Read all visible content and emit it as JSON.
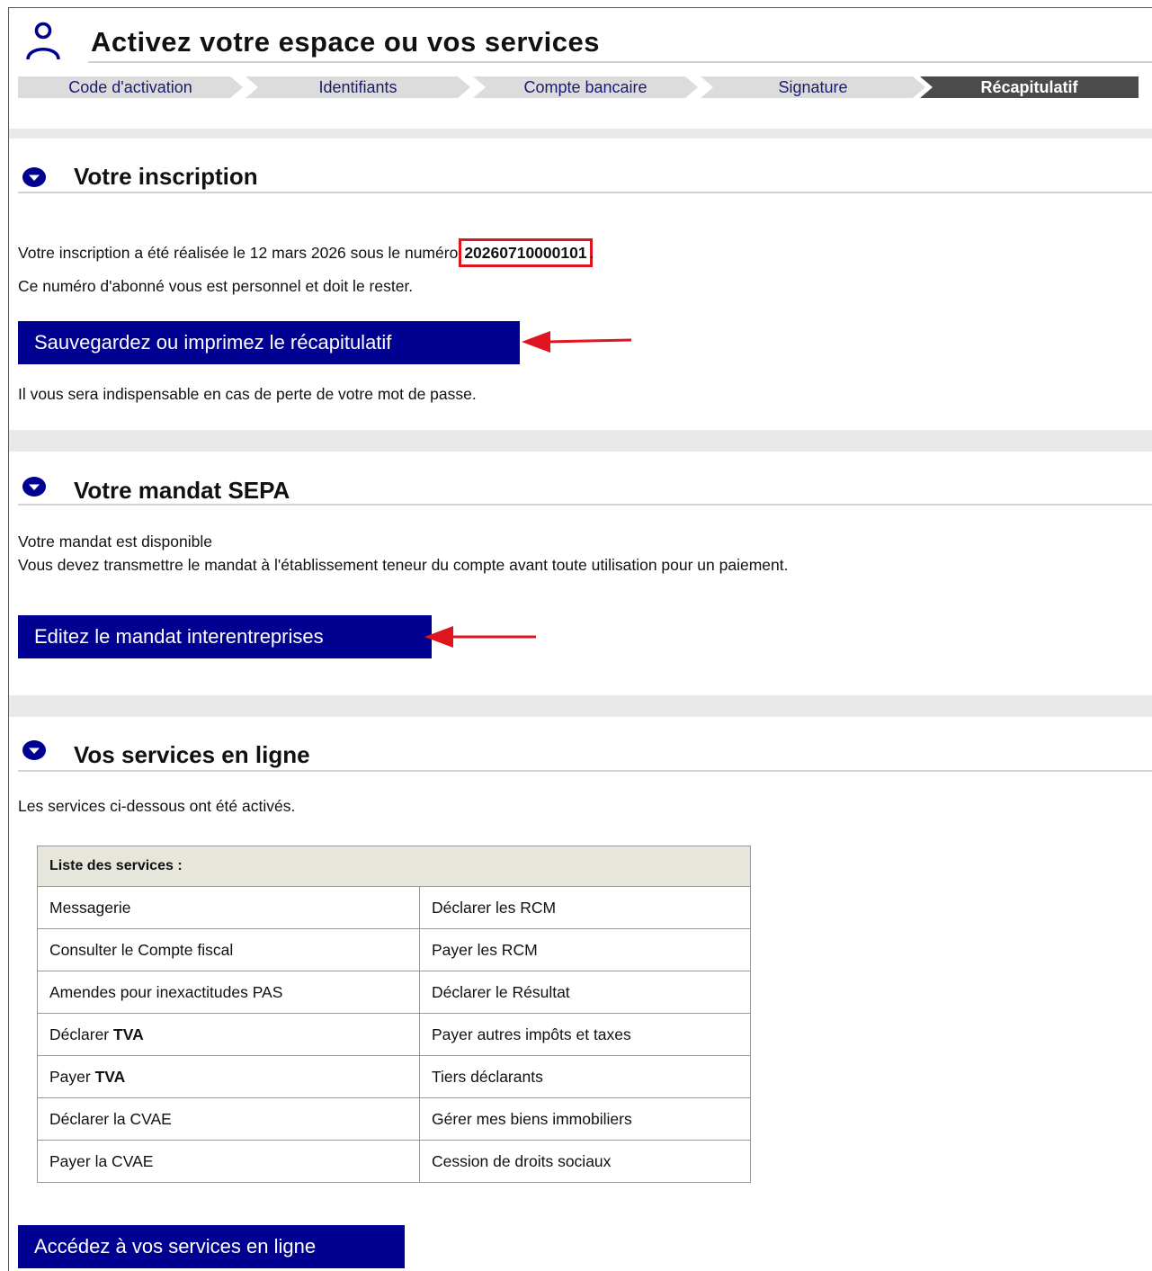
{
  "header": {
    "title": "Activez votre espace ou vos services",
    "icon": "user-icon"
  },
  "stepper": {
    "steps": [
      "Code d'activation",
      "Identifiants",
      "Compte bancaire",
      "Signature",
      "Récapitulatif"
    ],
    "active_index": 4
  },
  "inscription": {
    "title": "Votre inscription",
    "line1_prefix": "Votre inscription a été réalisée le 12 mars 2026 sous le numéro",
    "number": "20260710000101",
    "line1_suffix": ".",
    "line2": "Ce numéro d'abonné vous est personnel et doit le rester.",
    "button": "Sauvegardez ou imprimez le récapitulatif",
    "note": "Il vous sera indispensable en cas de perte de votre mot de passe."
  },
  "mandat": {
    "title": "Votre mandat SEPA",
    "line1": "Votre mandat est disponible",
    "line2": "Vous devez transmettre le mandat à l'établissement teneur du compte avant toute utilisation pour un paiement.",
    "button": "Editez le mandat interentreprises"
  },
  "services": {
    "title": "Vos services en ligne",
    "intro": "Les services ci-dessous ont été activés.",
    "table_header": "Liste des services :",
    "rows": [
      [
        {
          "text": "Messagerie",
          "bold": ""
        },
        {
          "text": "Déclarer les RCM",
          "bold": ""
        }
      ],
      [
        {
          "text": "Consulter le Compte fiscal",
          "bold": ""
        },
        {
          "text": "Payer les RCM",
          "bold": ""
        }
      ],
      [
        {
          "text": "Amendes pour inexactitudes PAS",
          "bold": ""
        },
        {
          "text": "Déclarer le Résultat",
          "bold": ""
        }
      ],
      [
        {
          "text": "Déclarer ",
          "bold": "TVA"
        },
        {
          "text": "Payer autres impôts et taxes",
          "bold": ""
        }
      ],
      [
        {
          "text": "Payer ",
          "bold": "TVA"
        },
        {
          "text": "Tiers déclarants",
          "bold": ""
        }
      ],
      [
        {
          "text": "Déclarer la CVAE",
          "bold": ""
        },
        {
          "text": "Gérer mes biens immobiliers",
          "bold": ""
        }
      ],
      [
        {
          "text": "Payer la CVAE",
          "bold": ""
        },
        {
          "text": "Cession de droits sociaux",
          "bold": ""
        }
      ]
    ],
    "button": "Accédez à vos services en ligne"
  },
  "colors": {
    "primary_button": "#000091",
    "highlight_box": "#e0141e",
    "annotation_arrow": "#e0141e",
    "active_step": "#4b4b4b"
  }
}
